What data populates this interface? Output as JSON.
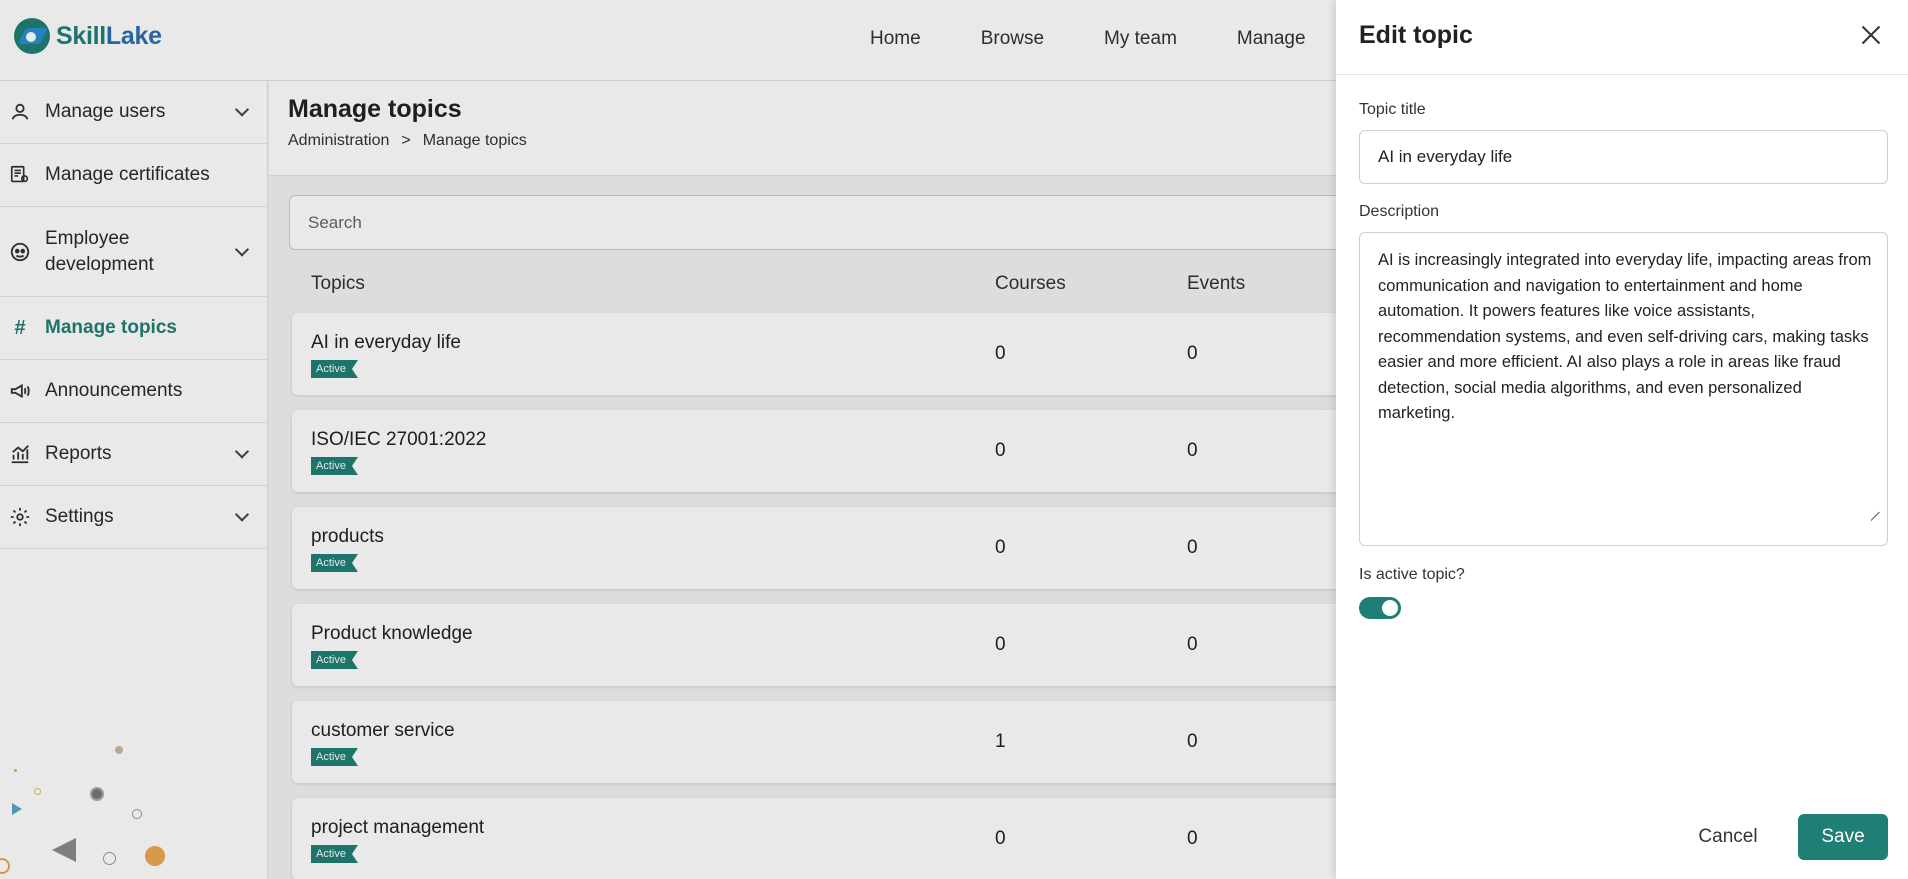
{
  "app": {
    "logo_part1": "Skill",
    "logo_part2": "Lake"
  },
  "topnav": [
    {
      "label": "Home"
    },
    {
      "label": "Browse"
    },
    {
      "label": "My team"
    },
    {
      "label": "Manage"
    }
  ],
  "sidebar": {
    "items": [
      {
        "label": "Manage users",
        "icon": "user-icon",
        "expandable": true
      },
      {
        "label": "Manage certificates",
        "icon": "certificate-icon",
        "expandable": false
      },
      {
        "label": "Employee development",
        "icon": "face-icon",
        "expandable": true
      },
      {
        "label": "Manage topics",
        "icon": "hash-icon",
        "expandable": false,
        "active": true
      },
      {
        "label": "Announcements",
        "icon": "megaphone-icon",
        "expandable": false
      },
      {
        "label": "Reports",
        "icon": "chart-icon",
        "expandable": true
      },
      {
        "label": "Settings",
        "icon": "gear-icon",
        "expandable": true
      }
    ]
  },
  "page": {
    "title": "Manage topics",
    "breadcrumb": [
      "Administration",
      ">",
      "Manage topics"
    ],
    "search_placeholder": "Search"
  },
  "table": {
    "headers": {
      "topics": "Topics",
      "courses": "Courses",
      "events": "Events"
    },
    "rows": [
      {
        "name": "AI in everyday life",
        "status": "Active",
        "courses": "0",
        "events": "0"
      },
      {
        "name": "ISO/IEC 27001:2022",
        "status": "Active",
        "courses": "0",
        "events": "0"
      },
      {
        "name": "products",
        "status": "Active",
        "courses": "0",
        "events": "0"
      },
      {
        "name": "Product knowledge",
        "status": "Active",
        "courses": "0",
        "events": "0"
      },
      {
        "name": "customer service",
        "status": "Active",
        "courses": "1",
        "events": "0"
      },
      {
        "name": "project management",
        "status": "Active",
        "courses": "0",
        "events": "0"
      }
    ]
  },
  "drawer": {
    "title": "Edit topic",
    "title_label": "Topic title",
    "title_value": "AI in everyday life",
    "description_label": "Description",
    "description_value": "AI is increasingly integrated into everyday life, impacting areas from communication and navigation to entertainment and home automation. It powers features like voice assistants, recommendation systems, and even self-driving cars, making tasks easier and more efficient. AI also plays a role in areas like fraud detection, social media algorithms, and even personalized marketing.",
    "active_label": "Is active topic?",
    "active": true,
    "cancel_label": "Cancel",
    "save_label": "Save"
  },
  "colors": {
    "accent": "#1f7f74",
    "badge": "#1f7f74",
    "save_button": "#1f7f74"
  }
}
